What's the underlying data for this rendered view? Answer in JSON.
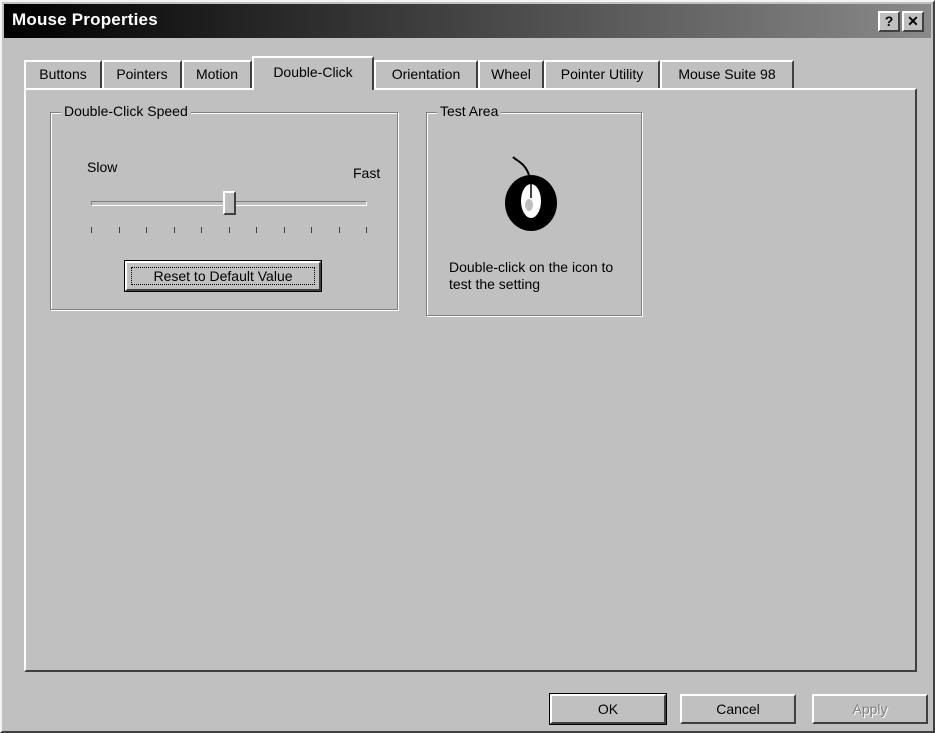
{
  "window": {
    "title": "Mouse Properties",
    "help_glyph": "?",
    "close_glyph": "✕"
  },
  "tabs": [
    {
      "label": "Buttons"
    },
    {
      "label": "Pointers"
    },
    {
      "label": "Motion"
    },
    {
      "label": "Double-Click",
      "active": true
    },
    {
      "label": "Orientation"
    },
    {
      "label": "Wheel"
    },
    {
      "label": "Pointer Utility"
    },
    {
      "label": "Mouse Suite 98"
    }
  ],
  "double_click_speed": {
    "group_label": "Double-Click Speed",
    "slow_label": "Slow",
    "fast_label": "Fast",
    "slider_position": 0.5,
    "tick_count": 11,
    "reset_label": "Reset to Default Value"
  },
  "test_area": {
    "group_label": "Test Area",
    "icon": "mouse-icon",
    "instruction": "Double-click on the icon to test the setting"
  },
  "buttons": {
    "ok": "OK",
    "cancel": "Cancel",
    "apply": "Apply"
  },
  "colors": {
    "face": "#c0c0c0",
    "title_start": "#000000",
    "title_end": "#8a8a8a"
  }
}
